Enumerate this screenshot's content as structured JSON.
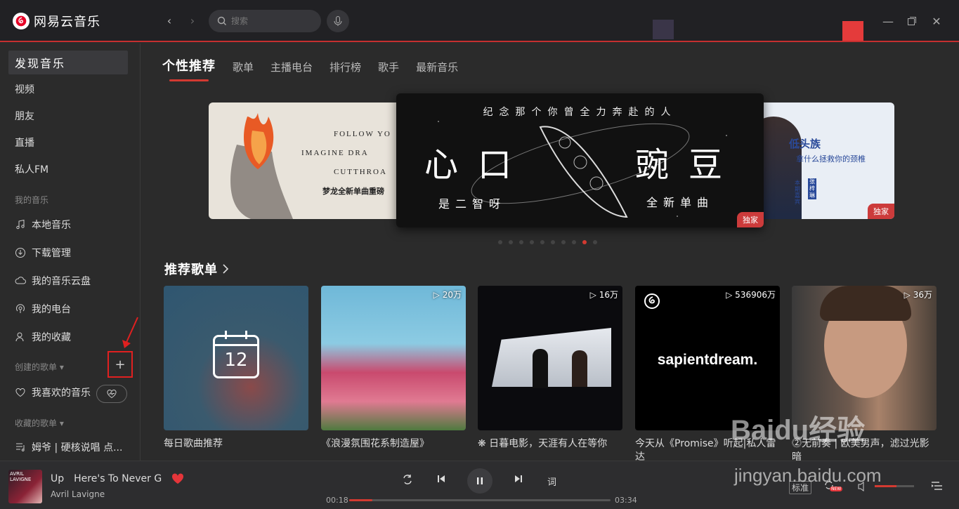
{
  "app": {
    "title": "网易云音乐"
  },
  "search": {
    "placeholder": "搜索"
  },
  "sidebar": {
    "items": [
      {
        "label": "发现音乐"
      },
      {
        "label": "视频"
      },
      {
        "label": "朋友"
      },
      {
        "label": "直播"
      },
      {
        "label": "私人FM"
      }
    ],
    "my_music_title": "我的音乐",
    "my_music": [
      {
        "label": "本地音乐",
        "icon": "music-note-icon"
      },
      {
        "label": "下载管理",
        "icon": "download-icon"
      },
      {
        "label": "我的音乐云盘",
        "icon": "cloud-icon"
      },
      {
        "label": "我的电台",
        "icon": "radio-icon"
      },
      {
        "label": "我的收藏",
        "icon": "collect-icon"
      }
    ],
    "created_title": "创建的歌单",
    "liked_label": "我喜欢的音乐",
    "collected_title": "收藏的歌单",
    "collected_first": "姆爷 | 硬核说唱 点..."
  },
  "tabs": [
    {
      "label": "个性推荐"
    },
    {
      "label": "歌单"
    },
    {
      "label": "主播电台"
    },
    {
      "label": "排行榜"
    },
    {
      "label": "歌手"
    },
    {
      "label": "最新音乐"
    }
  ],
  "banners": {
    "left": {
      "lines": [
        "FOLLOW YO",
        "IMAGINE DRA",
        "CUTTHROA"
      ],
      "caption": "梦龙全新单曲重磅"
    },
    "center": {
      "top": "纪念那个你曾全力奔赴的人",
      "big_left": "心口",
      "big_right": "豌豆",
      "bottom_left": "是二智呀",
      "bottom_right": "全新单曲",
      "badge": "独家"
    },
    "right": {
      "title": "低头族",
      "subtitle": "拿什么拯救你的颈椎",
      "badge": "独家",
      "guest": "本期嘉宾",
      "guest_name": "张梓琳"
    },
    "dot_count": 10,
    "active_dot": 8
  },
  "section": {
    "title": "推荐歌单"
  },
  "playlists": [
    {
      "title": "每日歌曲推荐",
      "count": "",
      "day": "12"
    },
    {
      "title": "《浪漫氛围花系制造屋》",
      "count": "▷ 20万"
    },
    {
      "title": "❋ 日暮电影，天涯有人在等你",
      "count": "▷ 16万"
    },
    {
      "title": "今天从《Promise》听起|私人雷达",
      "count": "▷ 536906万",
      "brand": "sapientdream."
    },
    {
      "title": "⓶无前奏 | 欧美男声，滤过光影 暗",
      "count": "▷ 36万"
    }
  ],
  "player": {
    "song": "Up",
    "song2": "Here's To Never G",
    "artist": "Avril Lavigne",
    "album_text": "AVRIL LAVIGNE",
    "current": "00:18",
    "total": "03:34",
    "progress": 0.09,
    "lyrics_label": "词",
    "quality": "标准",
    "new_badge": "NEW",
    "volume": 0.55
  },
  "watermark": {
    "brand": "Baidu经验",
    "url": "jingyan.baidu.com"
  },
  "colors": {
    "accent": "#d33a31",
    "topbar": "#212124",
    "bg": "#2b2b2b"
  }
}
